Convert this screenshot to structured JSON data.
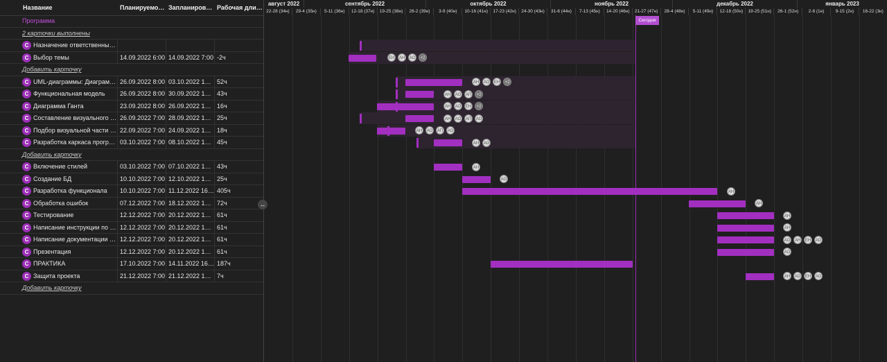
{
  "headers": {
    "name": "Название",
    "planned": "Планируемое н...",
    "scheduled": "Запланирован...",
    "duration": "Рабочая длите..."
  },
  "program_label": "Программа",
  "done_label": "2 карточки выполнены",
  "add_card_label": "Добавить карточку",
  "badge_letter": "C",
  "rows": [
    {
      "name": "Назначение ответственных н...",
      "start": "",
      "end": "",
      "dur": ""
    },
    {
      "name": "Выбор темы",
      "start": "14.09.2022 6:00",
      "end": "14.09.2022 7:00",
      "dur": "-2ч"
    },
    {
      "name": "UML-диаграммы: Диаграмма...",
      "start": "26.09.2022 8:00",
      "end": "03.10.2022 16:00",
      "dur": "52ч"
    },
    {
      "name": "Функциональная модель",
      "start": "26.09.2022 8:00",
      "end": "30.09.2022 16:00",
      "dur": "43ч"
    },
    {
      "name": "Диаграмма Ганта",
      "start": "23.09.2022 8:00",
      "end": "26.09.2022 16:00",
      "dur": "16ч"
    },
    {
      "name": "Составление визуального ма...",
      "start": "26.09.2022 7:00",
      "end": "28.09.2022 16:00",
      "dur": "25ч"
    },
    {
      "name": "Подбор визуальной части са...",
      "start": "22.09.2022 7:00",
      "end": "24.09.2022 16:00",
      "dur": "18ч"
    },
    {
      "name": "Разработка каркаса програм...",
      "start": "03.10.2022 7:00",
      "end": "08.10.2022 16:00",
      "dur": "45ч"
    },
    {
      "name": "Включение стилей",
      "start": "03.10.2022 7:00",
      "end": "07.10.2022 16:00",
      "dur": "43ч"
    },
    {
      "name": "Создание БД",
      "start": "10.10.2022 7:00",
      "end": "12.10.2022 16:00",
      "dur": "25ч"
    },
    {
      "name": "Разработка функционала",
      "start": "10.10.2022 7:00",
      "end": "11.12.2022 16:00",
      "dur": "405ч"
    },
    {
      "name": "Обработка ошибок",
      "start": "07.12.2022 7:00",
      "end": "18.12.2022 16:00",
      "dur": "72ч"
    },
    {
      "name": "Тестирование",
      "start": "12.12.2022 7:00",
      "end": "20.12.2022 16:00",
      "dur": "61ч"
    },
    {
      "name": "Написание инструкции по по...",
      "start": "12.12.2022 7:00",
      "end": "20.12.2022 16:00",
      "dur": "61ч"
    },
    {
      "name": "Написание документации по...",
      "start": "12.12.2022 7:00",
      "end": "20.12.2022 16:00",
      "dur": "61ч"
    },
    {
      "name": "Презентация",
      "start": "12.12.2022 7:00",
      "end": "20.12.2022 16:00",
      "dur": "61ч"
    },
    {
      "name": "ПРАКТИКА",
      "start": "17.10.2022 7:00",
      "end": "14.11.2022 16:00",
      "dur": "187ч"
    },
    {
      "name": "Защита проекта",
      "start": "21.12.2022 7:00",
      "end": "21.12.2022 16:00",
      "dur": "7ч"
    }
  ],
  "months": [
    "август 2022",
    "сентябрь 2022",
    "октябрь 2022",
    "ноябрь 2022",
    "декабрь 2022",
    "январь 2023"
  ],
  "weeks": [
    "22-28 (34н)",
    "29-4 (35н)",
    "5-11 (36н)",
    "12-18 (37н)",
    "19-25 (38н)",
    "26-2 (39н)",
    "3-9 (40н)",
    "10-16 (41н)",
    "17-23 (42н)",
    "24-30 (43н)",
    "31-6 (44н)",
    "7-13 (45н)",
    "14-20 (46н)",
    "21-27 (47н)",
    "28-4 (48н)",
    "5-11 (49н)",
    "12-18 (50н)",
    "19-25 (51н)",
    "26-1 (52н)",
    "2-8 (1н)",
    "9-15 (2н)",
    "16-22 (3н)"
  ],
  "today_label": "Сегодня",
  "avatars": {
    "r1": [
      "ЕН",
      "АН",
      "АО",
      "+2"
    ],
    "r2": [
      "АН",
      "АО",
      "ЕН",
      "+2"
    ],
    "r3": [
      "АН",
      "АО",
      "АП",
      "+2"
    ],
    "r4": [
      "АН",
      "АО",
      "ЕН",
      "+2"
    ],
    "r5": [
      "АН",
      "АО",
      "АП",
      "АО"
    ],
    "r6": [
      "АН",
      "АО",
      "АП",
      "АО"
    ],
    "r7": [
      "АН",
      "АО"
    ],
    "r8": [
      "АН"
    ],
    "r9": [
      "АО"
    ],
    "r10": [
      "АН"
    ],
    "r11": [
      "АН"
    ],
    "r12": [
      "АН"
    ],
    "r13": [
      "АН"
    ],
    "r14": [
      "АО",
      "АН",
      "ЕН",
      "АО"
    ],
    "r15": [
      "АО"
    ],
    "r17": [
      "АН",
      "АО",
      "ЕН",
      "АО"
    ]
  },
  "colors": {
    "accent": "#a22fc0",
    "background": "#1f1f1f"
  }
}
